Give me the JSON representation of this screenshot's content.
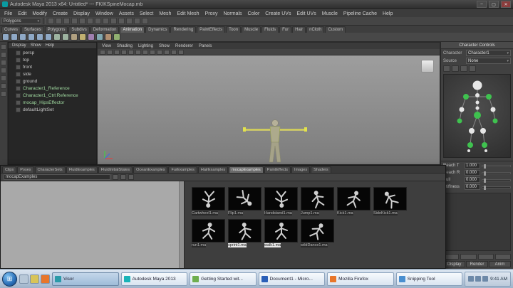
{
  "window": {
    "title": "Autodesk Maya 2013 x64: Untitled* --- FKIKSpineMocap.mb",
    "minimize": "–",
    "maximize": "▢",
    "close": "✕"
  },
  "menu_bar": {
    "items": [
      "File",
      "Edit",
      "Modify",
      "Create",
      "Display",
      "Window",
      "Assets",
      "Select",
      "Mesh",
      "Edit Mesh",
      "Proxy",
      "Normals",
      "Color",
      "Create UVs",
      "Edit UVs",
      "Muscle",
      "Pipeline Cache",
      "Help"
    ]
  },
  "status_line": {
    "menuset": "Polygons",
    "icons": [
      {
        "name": "new-scene-icon"
      },
      {
        "name": "open-scene-icon"
      },
      {
        "name": "save-scene-icon"
      },
      {
        "name": "undo-icon"
      },
      {
        "name": "redo-icon"
      },
      {
        "name": "snap-to-grid-icon"
      },
      {
        "name": "snap-to-curve-icon"
      },
      {
        "name": "snap-to-point-icon"
      },
      {
        "name": "snap-to-view-plane-icon"
      },
      {
        "name": "make-live-icon"
      },
      {
        "name": "render-current-frame-icon"
      },
      {
        "name": "ipr-render-icon"
      },
      {
        "name": "render-settings-icon"
      }
    ]
  },
  "shelf": {
    "tabs": [
      {
        "label": "Curves"
      },
      {
        "label": "Surfaces"
      },
      {
        "label": "Polygons"
      },
      {
        "label": "Subdivs"
      },
      {
        "label": "Deformation"
      },
      {
        "label": "Animation",
        "active": true
      },
      {
        "label": "Dynamics"
      },
      {
        "label": "Rendering"
      },
      {
        "label": "PaintEffects"
      },
      {
        "label": "Toon"
      },
      {
        "label": "Muscle"
      },
      {
        "label": "Fluids"
      },
      {
        "label": "Fur"
      },
      {
        "label": "Hair"
      },
      {
        "label": "nCloth"
      },
      {
        "label": "Custom"
      }
    ],
    "icons": [
      {
        "name": "poly-sphere-icon",
        "color": "#8fa9c6"
      },
      {
        "name": "poly-cube-icon",
        "color": "#8fa9c6"
      },
      {
        "name": "poly-cylinder-icon",
        "color": "#8fa9c6"
      },
      {
        "name": "poly-cone-icon",
        "color": "#8fa9c6"
      },
      {
        "name": "poly-plane-icon",
        "color": "#8fa9c6"
      },
      {
        "name": "poly-torus-icon",
        "color": "#8fa9c6"
      },
      {
        "name": "poly-pyramid-icon",
        "color": "#9db3a0"
      },
      {
        "name": "poly-pipe-icon",
        "color": "#9db3a0"
      },
      {
        "name": "poly-helix-icon",
        "color": "#b0a080"
      },
      {
        "name": "poly-text-icon",
        "color": "#c0b070"
      },
      {
        "name": "boolean-union-icon",
        "color": "#a080b0"
      },
      {
        "name": "combine-icon",
        "color": "#80a8b0"
      },
      {
        "name": "extrude-icon",
        "color": "#b08f70"
      },
      {
        "name": "bevel-icon",
        "color": "#90b070"
      }
    ]
  },
  "toolbox": {
    "icons": [
      {
        "name": "select-tool-icon"
      },
      {
        "name": "lasso-tool-icon"
      },
      {
        "name": "paint-select-tool-icon"
      },
      {
        "name": "move-tool-icon"
      },
      {
        "name": "rotate-tool-icon"
      },
      {
        "name": "scale-tool-icon"
      },
      {
        "name": "last-tool-icon"
      }
    ]
  },
  "outliner": {
    "menu": [
      "Display",
      "Show",
      "Help"
    ],
    "items": [
      {
        "label": "persp"
      },
      {
        "label": "top"
      },
      {
        "label": "front"
      },
      {
        "label": "side"
      },
      {
        "label": "ground"
      },
      {
        "label": "Character1_Reference",
        "color": "#9fd89f"
      },
      {
        "label": "Character1_Ctrl:Reference",
        "color": "#9fd89f"
      },
      {
        "label": "mocap_HipsEffector",
        "color": "#9fd89f"
      },
      {
        "label": "defaultLightSet"
      }
    ]
  },
  "viewport": {
    "menu": [
      "View",
      "Shading",
      "Lighting",
      "Show",
      "Renderer",
      "Panels"
    ],
    "icons": [
      {
        "name": "select-camera-icon"
      },
      {
        "name": "lock-camera-icon"
      },
      {
        "name": "camera-attributes-icon"
      },
      {
        "name": "bookmark-icon"
      },
      {
        "name": "image-plane-icon"
      },
      {
        "name": "2d-pan-zoom-icon"
      },
      {
        "name": "grease-pencil-icon"
      },
      {
        "name": "grid-icon"
      },
      {
        "name": "film-gate-icon"
      },
      {
        "name": "resolution-gate-icon"
      },
      {
        "name": "gate-mask-icon"
      },
      {
        "name": "safe-action-icon"
      }
    ]
  },
  "humanik": {
    "panel_title": "Character Controls",
    "character_label": "Character",
    "character_value": "Character1",
    "source_label": "Source",
    "source_value": " None ",
    "rows": [
      {
        "label": "Reach T",
        "value": "1.000"
      },
      {
        "label": "Reach R",
        "value": "0.000"
      },
      {
        "label": "Pull",
        "value": "0.000"
      },
      {
        "label": "Stiffness",
        "value": "0.000"
      }
    ],
    "tabs": [
      {
        "label": "Display"
      },
      {
        "label": "Render"
      },
      {
        "label": "Anim"
      }
    ]
  },
  "visor": {
    "tabs": [
      {
        "label": "Clips"
      },
      {
        "label": "Poses"
      },
      {
        "label": "CharacterSets"
      },
      {
        "label": "FluidExamples"
      },
      {
        "label": "FluidInitialStates"
      },
      {
        "label": "OceanExamples"
      },
      {
        "label": "FurExamples"
      },
      {
        "label": "HairExamples"
      },
      {
        "label": "mocapExamples",
        "active": true
      },
      {
        "label": "PaintEffects"
      },
      {
        "label": "Images"
      },
      {
        "label": "Shaders"
      }
    ],
    "path": "mocapExamples",
    "thumbs": [
      {
        "name": "Cartwheel1.ma"
      },
      {
        "name": "Flip1.ma"
      },
      {
        "name": "Handstand1.ma"
      },
      {
        "name": "Jump1.ma"
      },
      {
        "name": "Kick1.ma"
      },
      {
        "name": "SideKick1.ma"
      },
      {
        "name": "run1.ma"
      },
      {
        "name": "sprint1.ma",
        "selected": true
      },
      {
        "name": "walk1.ma",
        "selected": true
      },
      {
        "name": "wildDance1.ma"
      }
    ]
  },
  "taskbar": {
    "quick_launch": [
      {
        "name": "show-desktop-icon",
        "color": "#b8c8d8"
      },
      {
        "name": "explorer-icon",
        "color": "#d8c458"
      },
      {
        "name": "firefox-quicklaunch-icon",
        "color": "#e8762a"
      }
    ],
    "buttons": [
      {
        "label": "Visor",
        "color": "#2a9aa8",
        "active": true
      },
      {
        "label": "Autodesk Maya 2013",
        "color": "#18b3b8"
      },
      {
        "label": "Getting Started wit...",
        "color": "#6fae4e"
      },
      {
        "label": "Document1 - Micro...",
        "color": "#2a5fb8"
      },
      {
        "label": "Mozilla Firefox",
        "color": "#e8762a"
      },
      {
        "label": "Snipping Tool",
        "color": "#4a8fd0"
      }
    ],
    "tray_icons": [
      {
        "name": "volume-icon"
      },
      {
        "name": "network-icon"
      },
      {
        "name": "action-center-icon"
      }
    ],
    "tray_time": "9:41 AM"
  }
}
